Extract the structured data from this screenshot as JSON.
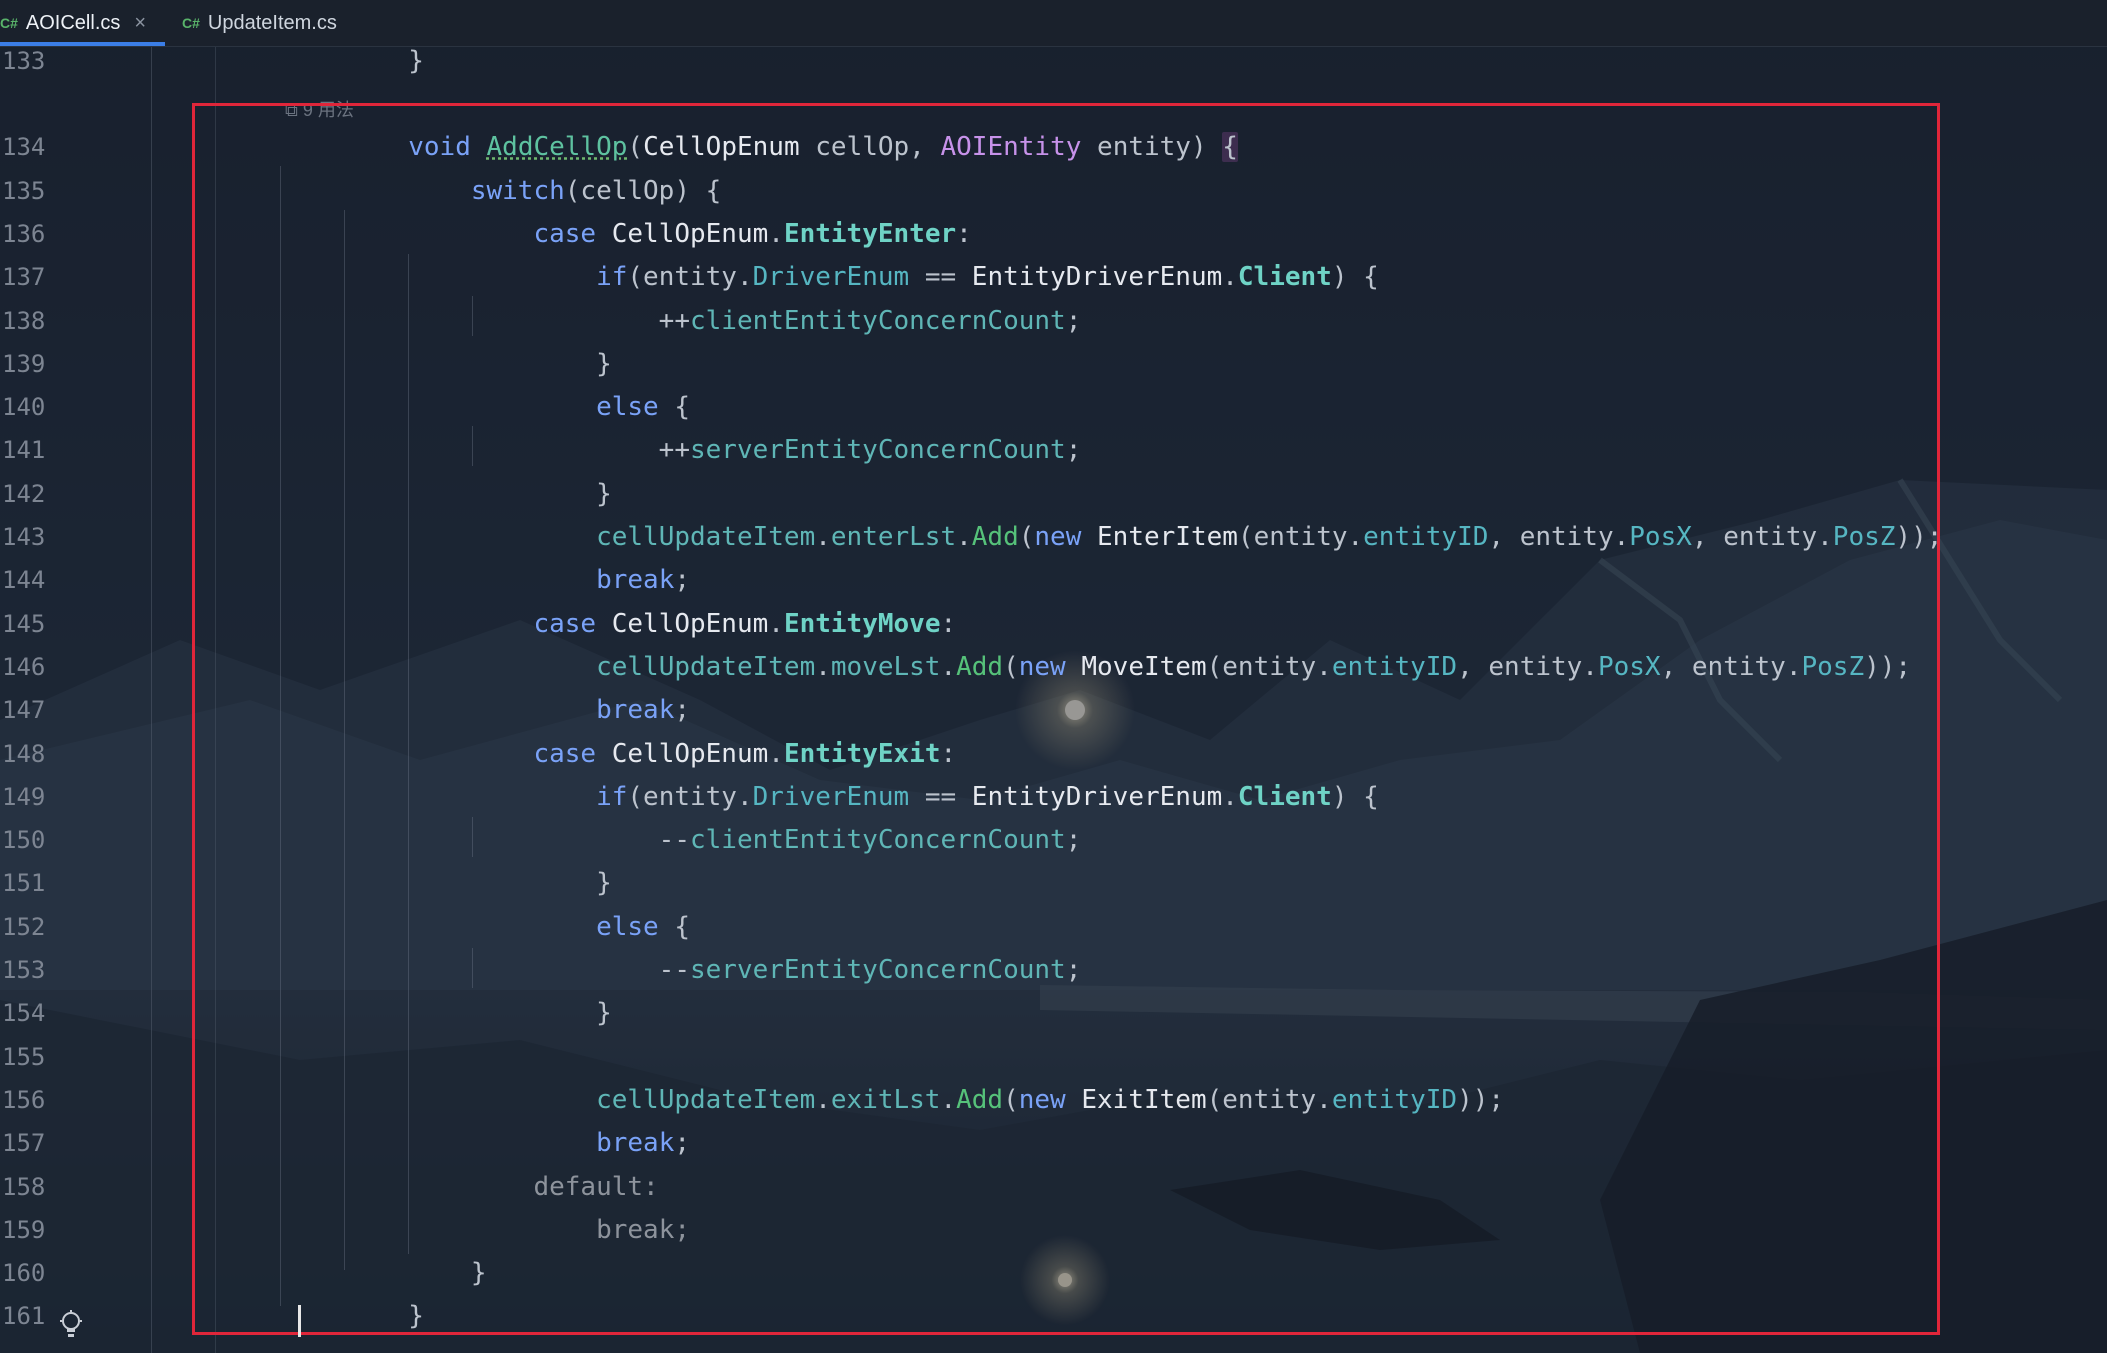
{
  "tabs": [
    {
      "icon": "C#",
      "label": "AOICell.cs",
      "active": true,
      "close": "×"
    },
    {
      "icon": "C#",
      "label": "UpdateItem.cs",
      "active": false
    }
  ],
  "usage_hint": "9 用法",
  "colors": {
    "highlight_box": "#e0263a",
    "active_tab_indicator": "#3b7ee6",
    "background": "#1b2330"
  },
  "code": {
    "lines": [
      {
        "n": "133",
        "tokens": [
          [
            "punc",
            "        }"
          ]
        ]
      },
      {
        "n": "134",
        "tokens": [
          [
            "punc",
            "        "
          ],
          [
            "kw",
            "void"
          ],
          [
            "punc",
            " "
          ],
          [
            "fn",
            "AddCellOp"
          ],
          [
            "punc",
            "("
          ],
          [
            "ty",
            "CellOpEnum"
          ],
          [
            "punc",
            " cellOp, "
          ],
          [
            "cls",
            "AOIEntity"
          ],
          [
            "punc",
            " entity) "
          ],
          [
            "punc",
            "{"
          ]
        ]
      },
      {
        "n": "135",
        "tokens": [
          [
            "punc",
            "            "
          ],
          [
            "kw",
            "switch"
          ],
          [
            "punc",
            "(cellOp) {"
          ]
        ]
      },
      {
        "n": "136",
        "tokens": [
          [
            "punc",
            "                "
          ],
          [
            "kw",
            "case"
          ],
          [
            "punc",
            " "
          ],
          [
            "ty",
            "CellOpEnum"
          ],
          [
            "punc",
            "."
          ],
          [
            "enumv",
            "EntityEnter"
          ],
          [
            "punc",
            ":"
          ]
        ]
      },
      {
        "n": "137",
        "tokens": [
          [
            "punc",
            "                    "
          ],
          [
            "kw",
            "if"
          ],
          [
            "punc",
            "(entity."
          ],
          [
            "prop",
            "DriverEnum"
          ],
          [
            "punc",
            " == "
          ],
          [
            "ty",
            "EntityDriverEnum"
          ],
          [
            "punc",
            "."
          ],
          [
            "enumv",
            "Client"
          ],
          [
            "punc",
            ") {"
          ]
        ]
      },
      {
        "n": "138",
        "tokens": [
          [
            "punc",
            "                        ++"
          ],
          [
            "mut",
            "clientEntityConcernCount"
          ],
          [
            "punc",
            ";"
          ]
        ]
      },
      {
        "n": "139",
        "tokens": [
          [
            "punc",
            "                    }"
          ]
        ]
      },
      {
        "n": "140",
        "tokens": [
          [
            "punc",
            "                    "
          ],
          [
            "kw",
            "else"
          ],
          [
            "punc",
            " {"
          ]
        ]
      },
      {
        "n": "141",
        "tokens": [
          [
            "punc",
            "                        ++"
          ],
          [
            "mut",
            "serverEntityConcernCount"
          ],
          [
            "punc",
            ";"
          ]
        ]
      },
      {
        "n": "142",
        "tokens": [
          [
            "punc",
            "                    }"
          ]
        ]
      },
      {
        "n": "143",
        "tokens": [
          [
            "punc",
            "                    "
          ],
          [
            "mut",
            "cellUpdateItem"
          ],
          [
            "punc",
            "."
          ],
          [
            "mut",
            "enterLst"
          ],
          [
            "punc",
            "."
          ],
          [
            "method",
            "Add"
          ],
          [
            "punc",
            "("
          ],
          [
            "kw",
            "new"
          ],
          [
            "punc",
            " "
          ],
          [
            "ty",
            "EnterItem"
          ],
          [
            "punc",
            "(entity."
          ],
          [
            "prop",
            "entityID"
          ],
          [
            "punc",
            ", entity."
          ],
          [
            "prop",
            "PosX"
          ],
          [
            "punc",
            ", entity."
          ],
          [
            "prop",
            "PosZ"
          ],
          [
            "punc",
            "));"
          ]
        ]
      },
      {
        "n": "144",
        "tokens": [
          [
            "punc",
            "                    "
          ],
          [
            "kw",
            "break"
          ],
          [
            "punc",
            ";"
          ]
        ]
      },
      {
        "n": "145",
        "tokens": [
          [
            "punc",
            "                "
          ],
          [
            "kw",
            "case"
          ],
          [
            "punc",
            " "
          ],
          [
            "ty",
            "CellOpEnum"
          ],
          [
            "punc",
            "."
          ],
          [
            "enumv",
            "EntityMove"
          ],
          [
            "punc",
            ":"
          ]
        ]
      },
      {
        "n": "146",
        "tokens": [
          [
            "punc",
            "                    "
          ],
          [
            "mut",
            "cellUpdateItem"
          ],
          [
            "punc",
            "."
          ],
          [
            "mut",
            "moveLst"
          ],
          [
            "punc",
            "."
          ],
          [
            "method",
            "Add"
          ],
          [
            "punc",
            "("
          ],
          [
            "kw",
            "new"
          ],
          [
            "punc",
            " "
          ],
          [
            "ty",
            "MoveItem"
          ],
          [
            "punc",
            "(entity."
          ],
          [
            "prop",
            "entityID"
          ],
          [
            "punc",
            ", entity."
          ],
          [
            "prop",
            "PosX"
          ],
          [
            "punc",
            ", entity."
          ],
          [
            "prop",
            "PosZ"
          ],
          [
            "punc",
            "));"
          ]
        ]
      },
      {
        "n": "147",
        "tokens": [
          [
            "punc",
            "                    "
          ],
          [
            "kw",
            "break"
          ],
          [
            "punc",
            ";"
          ]
        ]
      },
      {
        "n": "148",
        "tokens": [
          [
            "punc",
            "                "
          ],
          [
            "kw",
            "case"
          ],
          [
            "punc",
            " "
          ],
          [
            "ty",
            "CellOpEnum"
          ],
          [
            "punc",
            "."
          ],
          [
            "enumv",
            "EntityExit"
          ],
          [
            "punc",
            ":"
          ]
        ]
      },
      {
        "n": "149",
        "tokens": [
          [
            "punc",
            "                    "
          ],
          [
            "kw",
            "if"
          ],
          [
            "punc",
            "(entity."
          ],
          [
            "prop",
            "DriverEnum"
          ],
          [
            "punc",
            " == "
          ],
          [
            "ty",
            "EntityDriverEnum"
          ],
          [
            "punc",
            "."
          ],
          [
            "enumv",
            "Client"
          ],
          [
            "punc",
            ") {"
          ]
        ]
      },
      {
        "n": "150",
        "tokens": [
          [
            "punc",
            "                        --"
          ],
          [
            "mut",
            "clientEntityConcernCount"
          ],
          [
            "punc",
            ";"
          ]
        ]
      },
      {
        "n": "151",
        "tokens": [
          [
            "punc",
            "                    }"
          ]
        ]
      },
      {
        "n": "152",
        "tokens": [
          [
            "punc",
            "                    "
          ],
          [
            "kw",
            "else"
          ],
          [
            "punc",
            " {"
          ]
        ]
      },
      {
        "n": "153",
        "tokens": [
          [
            "punc",
            "                        --"
          ],
          [
            "mut",
            "serverEntityConcernCount"
          ],
          [
            "punc",
            ";"
          ]
        ]
      },
      {
        "n": "154",
        "tokens": [
          [
            "punc",
            "                    }"
          ]
        ]
      },
      {
        "n": "155",
        "tokens": []
      },
      {
        "n": "156",
        "tokens": [
          [
            "punc",
            "                    "
          ],
          [
            "mut",
            "cellUpdateItem"
          ],
          [
            "punc",
            "."
          ],
          [
            "mut",
            "exitLst"
          ],
          [
            "punc",
            "."
          ],
          [
            "method",
            "Add"
          ],
          [
            "punc",
            "("
          ],
          [
            "kw",
            "new"
          ],
          [
            "punc",
            " "
          ],
          [
            "ty",
            "ExitItem"
          ],
          [
            "punc",
            "(entity."
          ],
          [
            "prop",
            "entityID"
          ],
          [
            "punc",
            "));"
          ]
        ]
      },
      {
        "n": "157",
        "tokens": [
          [
            "punc",
            "                    "
          ],
          [
            "kw",
            "break"
          ],
          [
            "punc",
            ";"
          ]
        ]
      },
      {
        "n": "158",
        "tokens": [
          [
            "punc",
            "                "
          ],
          [
            "dim",
            "default:"
          ]
        ]
      },
      {
        "n": "159",
        "tokens": [
          [
            "punc",
            "                    "
          ],
          [
            "dim",
            "break;"
          ]
        ]
      },
      {
        "n": "160",
        "tokens": [
          [
            "punc",
            "            }"
          ]
        ]
      },
      {
        "n": "161",
        "tokens": [
          [
            "punc",
            "        }"
          ]
        ]
      }
    ]
  }
}
